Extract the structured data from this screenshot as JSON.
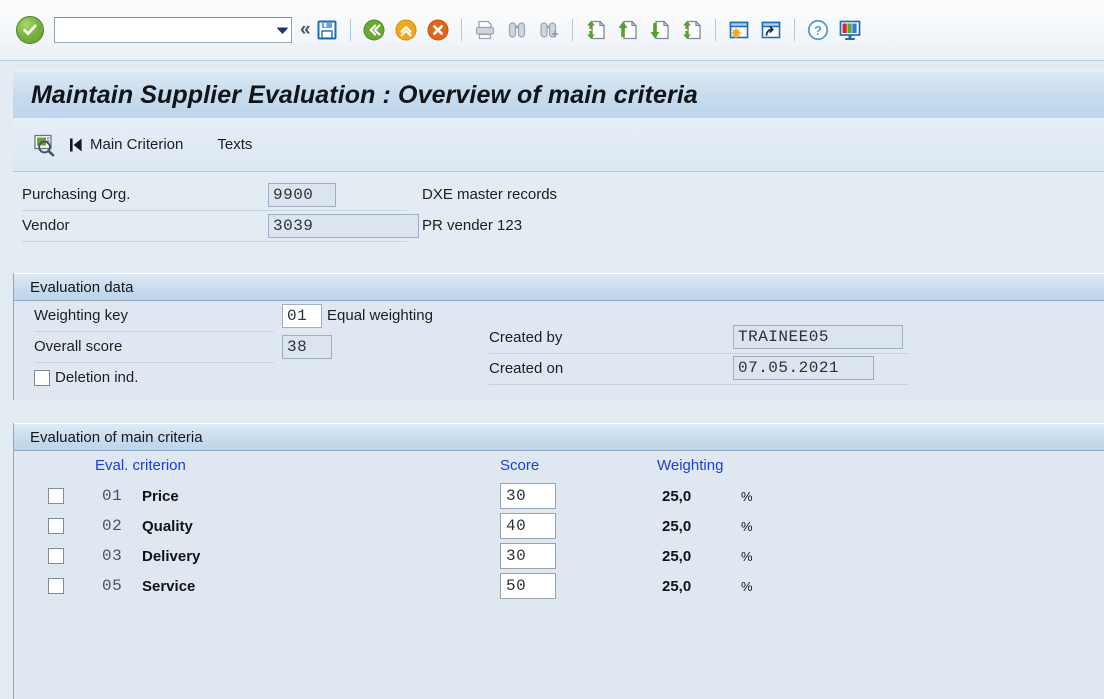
{
  "toolbar": {
    "ok_label": "ok-button",
    "command_value": "",
    "command_placeholder": "",
    "icons": [
      {
        "name": "save-icon",
        "title": "Save"
      },
      {
        "name": "back-icon",
        "title": "Back"
      },
      {
        "name": "exit-icon",
        "title": "Exit"
      },
      {
        "name": "cancel-icon",
        "title": "Cancel"
      },
      {
        "name": "print-icon",
        "title": "Print"
      },
      {
        "name": "find-icon",
        "title": "Find"
      },
      {
        "name": "find-next-icon",
        "title": "Find Next"
      },
      {
        "name": "first-page-icon",
        "title": "First Page"
      },
      {
        "name": "previous-page-icon",
        "title": "Previous Page"
      },
      {
        "name": "next-page-icon",
        "title": "Next Page"
      },
      {
        "name": "last-page-icon",
        "title": "Last Page"
      },
      {
        "name": "create-session-icon",
        "title": "Create New Session"
      },
      {
        "name": "create-shortcut-icon",
        "title": "Create Shortcut"
      },
      {
        "name": "help-icon",
        "title": "Help"
      },
      {
        "name": "customize-layout-icon",
        "title": "Customize Local Layout"
      }
    ]
  },
  "header": {
    "title": "Maintain Supplier Evaluation : Overview of main criteria"
  },
  "app_toolbar": {
    "overview_icon": "overview-icon",
    "main_criterion_label": "Main Criterion",
    "texts_label": "Texts"
  },
  "key_fields": {
    "purchasing_org": {
      "label": "Purchasing Org.",
      "value": "9900",
      "description": "DXE master records"
    },
    "vendor": {
      "label": "Vendor",
      "value": "3039",
      "description": "PR vender 123"
    }
  },
  "evaluation_data": {
    "section_title": "Evaluation data",
    "weighting_key": {
      "label": "Weighting key",
      "value": "01",
      "description": "Equal weighting"
    },
    "overall_score": {
      "label": "Overall score",
      "value": "38"
    },
    "deletion_indicator": {
      "label": "Deletion ind.",
      "checked": false
    },
    "created_by": {
      "label": "Created by",
      "value": "TRAINEE05"
    },
    "created_on": {
      "label": "Created on",
      "value": "07.05.2021"
    }
  },
  "main_criteria": {
    "section_title": "Evaluation of main criteria",
    "columns": {
      "criterion": "Eval. criterion",
      "score": "Score",
      "weighting": "Weighting"
    },
    "percent_symbol": "%",
    "rows": [
      {
        "selected": false,
        "code": "01",
        "name": "Price",
        "score": "30",
        "weighting": "25,0"
      },
      {
        "selected": false,
        "code": "02",
        "name": "Quality",
        "score": "40",
        "weighting": "25,0"
      },
      {
        "selected": false,
        "code": "03",
        "name": "Delivery",
        "score": "30",
        "weighting": "25,0"
      },
      {
        "selected": false,
        "code": "05",
        "name": "Service",
        "score": "50",
        "weighting": "25,0"
      }
    ]
  },
  "colors": {
    "accent_blue": "#1a3fd4",
    "title_bar": "#c8dcee",
    "section_header": "#c9dbed",
    "body_background": "#dfe8f1",
    "field_readonly": "#dce5ef",
    "ok_green": "#7cb342"
  }
}
